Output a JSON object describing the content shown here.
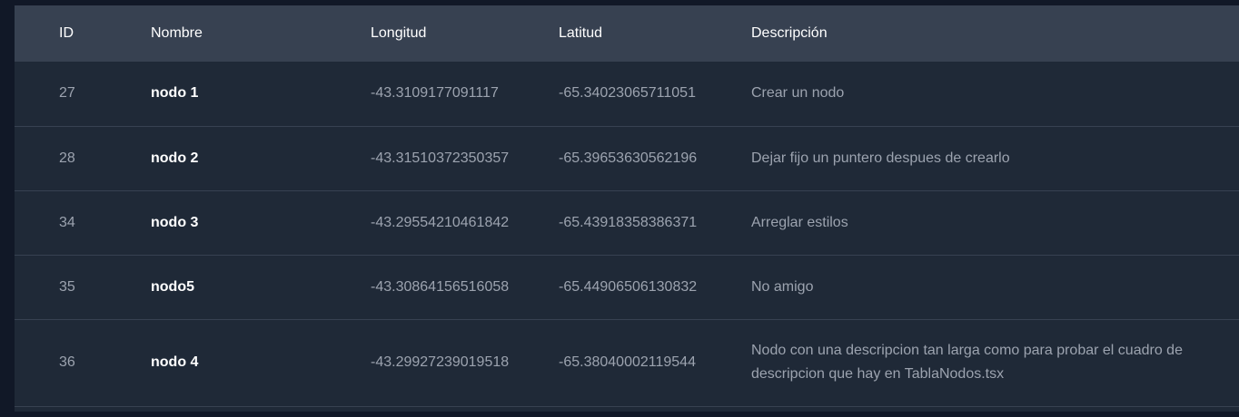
{
  "table": {
    "headers": {
      "id": "ID",
      "name": "Nombre",
      "longitude": "Longitud",
      "latitude": "Latitud",
      "description": "Descripción"
    },
    "rows": [
      {
        "id": "27",
        "name": "nodo 1",
        "longitude": "-43.3109177091117",
        "latitude": "-65.34023065711051",
        "description": "Crear un nodo"
      },
      {
        "id": "28",
        "name": "nodo 2",
        "longitude": "-43.31510372350357",
        "latitude": "-65.39653630562196",
        "description": "Dejar fijo un puntero despues de crearlo"
      },
      {
        "id": "34",
        "name": "nodo 3",
        "longitude": "-43.29554210461842",
        "latitude": "-65.43918358386371",
        "description": "Arreglar estilos"
      },
      {
        "id": "35",
        "name": "nodo5",
        "longitude": "-43.30864156516058",
        "latitude": "-65.44906506130832",
        "description": "No amigo"
      },
      {
        "id": "36",
        "name": "nodo 4",
        "longitude": "-43.29927239019518",
        "latitude": "-65.38040002119544",
        "description": "Nodo con una descripcion tan larga como para probar el cuadro de descripcion que hay en TablaNodos.tsx"
      }
    ]
  },
  "colors": {
    "page_background": "#111827",
    "table_background": "#1f2937",
    "header_background": "#374151",
    "header_text": "#ffffff",
    "cell_text": "#9ca3af",
    "name_text": "#ffffff"
  }
}
